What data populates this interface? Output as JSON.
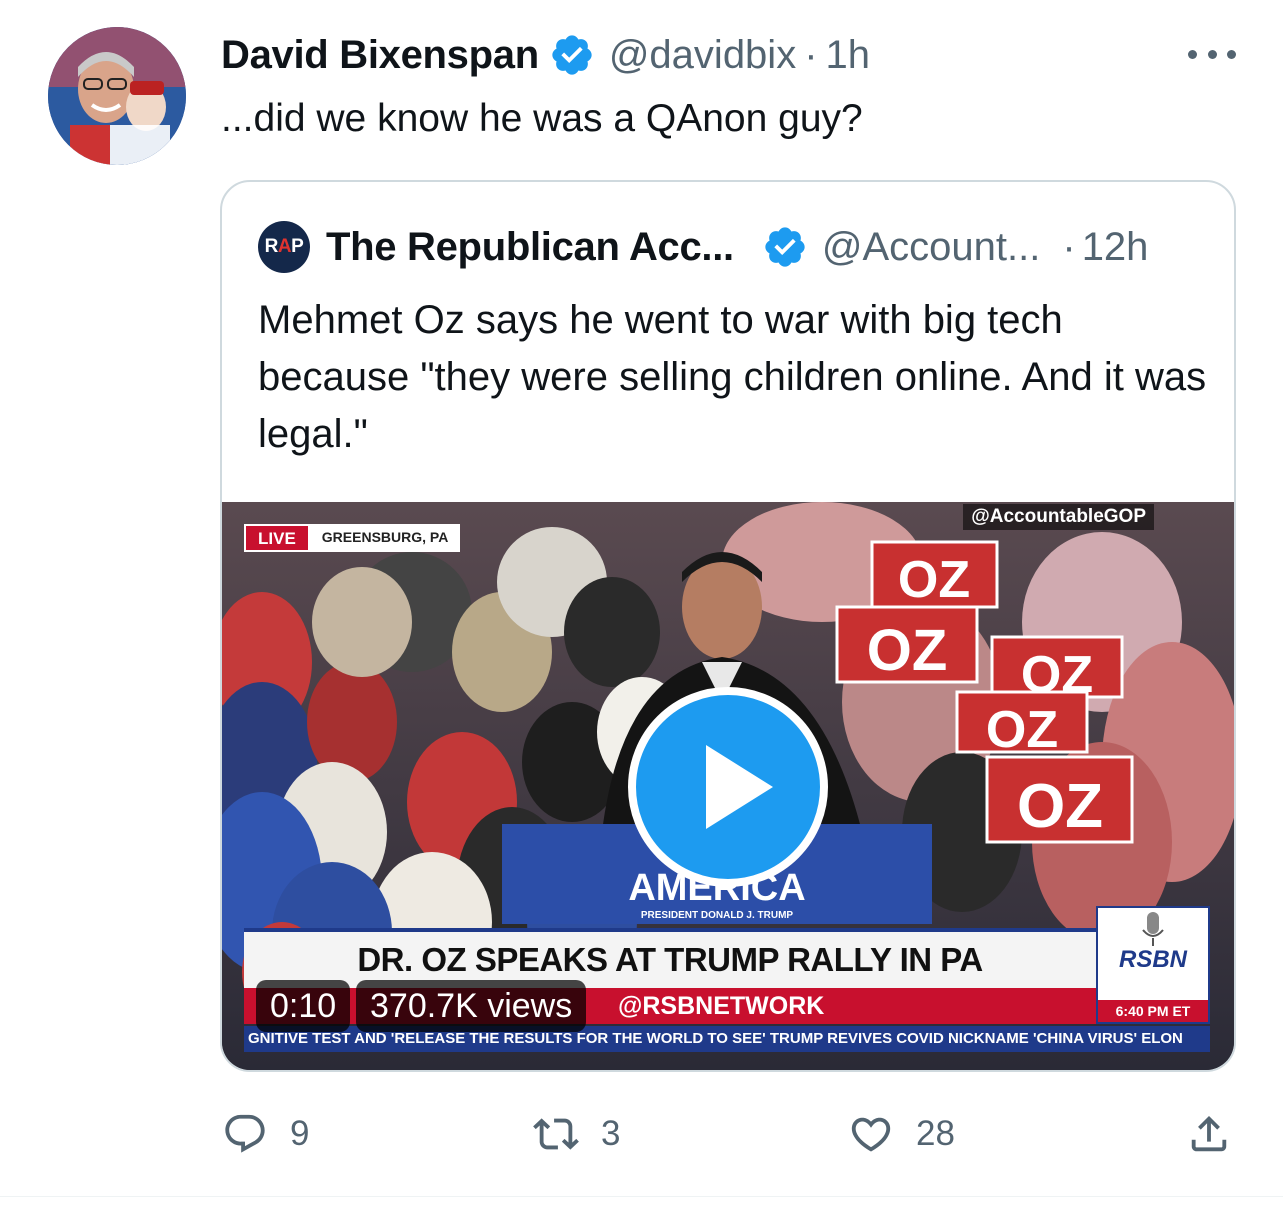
{
  "tweet": {
    "author_name": "David Bixenspan",
    "handle": "@davidbix",
    "separator": "·",
    "time": "1h",
    "text": "...did we know he was a QAnon guy?"
  },
  "quoted": {
    "logo_text_r": "R",
    "logo_text_a": "A",
    "logo_text_p": "P",
    "author_name": "The Republican Acc...",
    "handle": "@Account...",
    "separator": "·",
    "time": "12h",
    "text": "Mehmet Oz says he went to war with big tech because \"they were selling children online. And it was legal.\"",
    "media": {
      "live_label": "LIVE",
      "location": "GREENSBURG, PA",
      "watermark": "@AccountableGOP",
      "headline": "DR. OZ SPEAKS AT TRUMP RALLY IN PA",
      "network_strip": "@RSBNETWORK",
      "rsbn_logo": "RSBN",
      "clock": "6:40 PM  ET",
      "ticker": "GNITIVE TEST AND 'RELEASE THE RESULTS FOR THE WORLD TO SEE'    TRUMP REVIVES COVID NICKNAME 'CHINA VIRUS'    ELON",
      "podium_text": "AMERICA",
      "podium_sub": "PRESIDENT DONALD J. TRUMP",
      "duration": "0:10",
      "views": "370.7K views"
    }
  },
  "actions": {
    "replies": "9",
    "retweets": "3",
    "likes": "28"
  },
  "colors": {
    "verified": "#1d9bf0",
    "secondary_text": "#536471",
    "play_button": "#1d9bf0"
  },
  "icons": [
    "more-icon",
    "verified-icon",
    "reply-icon",
    "retweet-icon",
    "like-icon",
    "share-icon",
    "play-icon"
  ]
}
